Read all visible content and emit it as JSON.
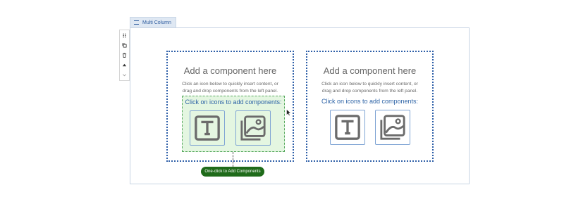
{
  "label_tab": {
    "text": "Multi Column"
  },
  "toolbar": {
    "icons": [
      "drag-handle-icon",
      "copy-icon",
      "delete-icon",
      "move-up-icon",
      "move-down-icon"
    ]
  },
  "columns": [
    {
      "heading": "Add a component here",
      "description": "Click an icon below to quickly insert content, or drag and drop components from the left panel.",
      "prompt": "Click on icons to add components:",
      "state": "highlighted"
    },
    {
      "heading": "Add a component here",
      "description": "Click an icon below to quickly insert content, or drag and drop components from the left panel.",
      "prompt": "Click on icons to add components:",
      "state": "default"
    }
  ],
  "component_icons": [
    "text-component-icon",
    "image-component-icon"
  ],
  "cta": {
    "label": "One-click to Add Components"
  },
  "colors": {
    "primary_blue": "#2e5fa8",
    "highlight_green": "#e4f6e1",
    "cta_green": "#1f6b1a"
  }
}
